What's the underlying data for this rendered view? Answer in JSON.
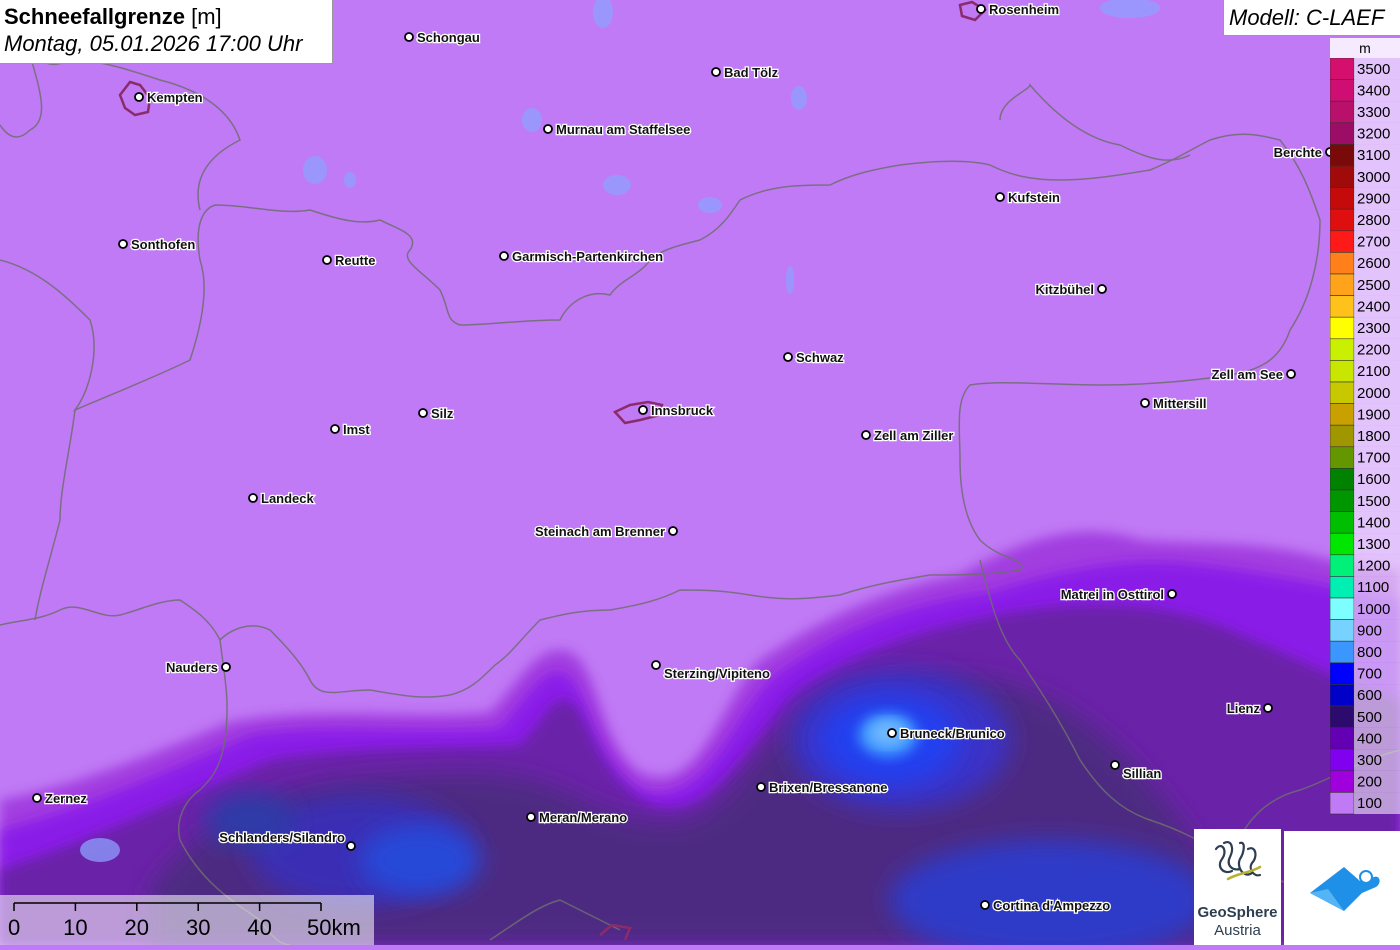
{
  "title": {
    "main": "Schneefallgrenze",
    "unit": "[m]",
    "datetime": "Montag, 05.01.2026 17:00 Uhr"
  },
  "model": "Modell: C-LAEF",
  "legend": {
    "unit": "m",
    "levels": [
      {
        "label": "3500",
        "color": "#d40f6e"
      },
      {
        "label": "3400",
        "color": "#cf0e74"
      },
      {
        "label": "3300",
        "color": "#b8106b"
      },
      {
        "label": "3200",
        "color": "#9c0d68"
      },
      {
        "label": "3100",
        "color": "#7a0a0a"
      },
      {
        "label": "3000",
        "color": "#a00a0a"
      },
      {
        "label": "2900",
        "color": "#c40a0a"
      },
      {
        "label": "2800",
        "color": "#e00f0f"
      },
      {
        "label": "2700",
        "color": "#ff1a1a"
      },
      {
        "label": "2600",
        "color": "#ff7f1a"
      },
      {
        "label": "2500",
        "color": "#ffa41a"
      },
      {
        "label": "2400",
        "color": "#ffc21a"
      },
      {
        "label": "2300",
        "color": "#ffff00"
      },
      {
        "label": "2200",
        "color": "#c8f000"
      },
      {
        "label": "2100",
        "color": "#c8e600"
      },
      {
        "label": "2000",
        "color": "#c8c800"
      },
      {
        "label": "1900",
        "color": "#c8a000"
      },
      {
        "label": "1800",
        "color": "#a09600"
      },
      {
        "label": "1700",
        "color": "#649600"
      },
      {
        "label": "1600",
        "color": "#008200"
      },
      {
        "label": "1500",
        "color": "#009600"
      },
      {
        "label": "1400",
        "color": "#00be00"
      },
      {
        "label": "1300",
        "color": "#00e600"
      },
      {
        "label": "1200",
        "color": "#00f078"
      },
      {
        "label": "1100",
        "color": "#00f0b4"
      },
      {
        "label": "1000",
        "color": "#7dffff"
      },
      {
        "label": "900",
        "color": "#78d2ff"
      },
      {
        "label": "800",
        "color": "#3c96ff"
      },
      {
        "label": "700",
        "color": "#0000ff"
      },
      {
        "label": "600",
        "color": "#0000c8"
      },
      {
        "label": "500",
        "color": "#2d0a6e"
      },
      {
        "label": "400",
        "color": "#6400b4"
      },
      {
        "label": "300",
        "color": "#8200f0"
      },
      {
        "label": "200",
        "color": "#a000dc"
      },
      {
        "label": "100",
        "color": "#c07af5"
      }
    ]
  },
  "cities": [
    {
      "name": "Rosenheim"
    },
    {
      "name": "Schongau"
    },
    {
      "name": "Kempten"
    },
    {
      "name": "Bad Tölz"
    },
    {
      "name": "Murnau am Staffelsee"
    },
    {
      "name": "Berchte"
    },
    {
      "name": "Kufstein"
    },
    {
      "name": "Sonthofen"
    },
    {
      "name": "Reutte"
    },
    {
      "name": "Garmisch-Partenkirchen"
    },
    {
      "name": "Kitzbühel"
    },
    {
      "name": "Schwaz"
    },
    {
      "name": "Zell am See"
    },
    {
      "name": "Mittersill"
    },
    {
      "name": "Silz"
    },
    {
      "name": "Innsbruck"
    },
    {
      "name": "Imst"
    },
    {
      "name": "Zell am Ziller"
    },
    {
      "name": "Landeck"
    },
    {
      "name": "Steinach am Brenner"
    },
    {
      "name": "Matrei in Osttirol"
    },
    {
      "name": "Nauders"
    },
    {
      "name": "Sterzing/Vipiteno"
    },
    {
      "name": "Lienz"
    },
    {
      "name": "Bruneck/Brunico"
    },
    {
      "name": "Sillian"
    },
    {
      "name": "Brixen/Bressanone"
    },
    {
      "name": "Zernez"
    },
    {
      "name": "Meran/Merano"
    },
    {
      "name": "Schlanders/Silandro"
    },
    {
      "name": "Cortina d'Ampezzo"
    }
  ],
  "scale": {
    "labels": [
      "0",
      "10",
      "20",
      "30",
      "40",
      "50km"
    ]
  },
  "logo": {
    "name": "GeoSphere",
    "sub": "Austria"
  }
}
